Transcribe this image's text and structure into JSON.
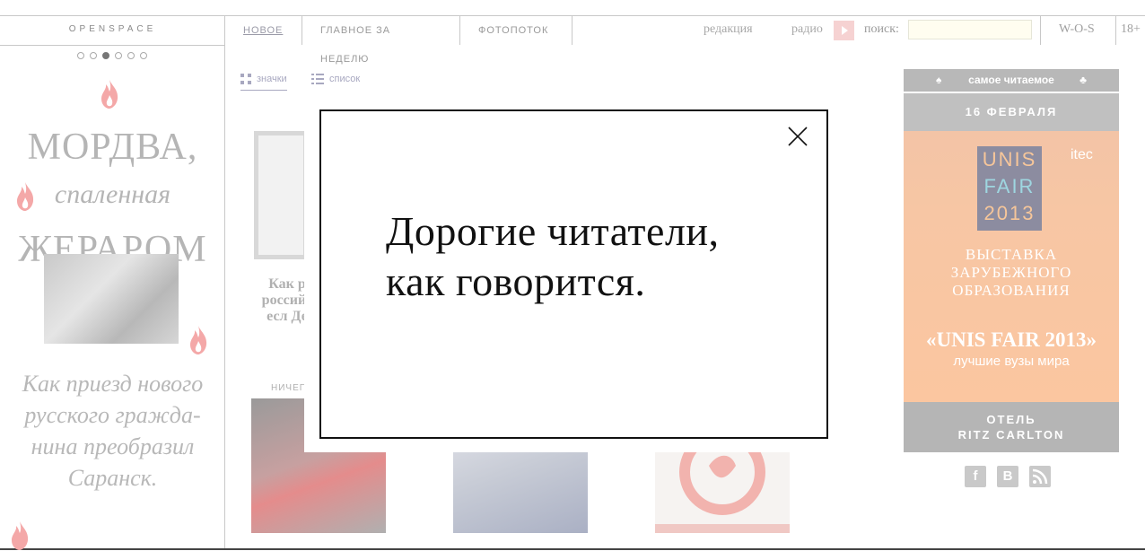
{
  "brand": "OPENSPACE",
  "tabs": [
    {
      "label": "НОВОЕ",
      "active": true
    },
    {
      "label": "ГЛАВНОЕ ЗА НЕДЕЛЮ",
      "active": false
    },
    {
      "label": "ФОТОПОТОК",
      "active": false
    }
  ],
  "nav": {
    "editorial": "редакция",
    "radio": "радио",
    "search_label": "поиск:",
    "search_value": "",
    "wos": "W-O-S",
    "age": "18+"
  },
  "slider": {
    "count": 6,
    "active_index": 2
  },
  "promo": {
    "title_line1": "МОРДВА,",
    "title_line2": "спаленная",
    "title_line3": "ЖЕРАРОМ",
    "text": "Как приезд нового русского гражда-нина преобразил Саранск."
  },
  "view": {
    "icons_label": "значки",
    "list_label": "список"
  },
  "cards": {
    "first_text": "Как р российс есл Де",
    "section_label": "НИЧЕГО"
  },
  "sidebar": {
    "header": "самое читаемое",
    "date": "16 ФЕВРАЛЯ",
    "ad": {
      "logo_line1": "UNIS",
      "logo_line2": "FAIR",
      "logo_line3": "2013",
      "brand": "itec",
      "headline_line1": "ВЫСТАВКА",
      "headline_line2": "ЗАРУБЕЖНОГО",
      "headline_line3": "ОБРАЗОВАНИЯ",
      "event": "«UNIS FAIR 2013»",
      "tagline": "лучшие вузы мира"
    },
    "footer_line1": "ОТЕЛЬ",
    "footer_line2": "RITZ CARLTON"
  },
  "social": [
    "f",
    "B"
  ],
  "modal": {
    "line1": "Дорогие читатели,",
    "line2": "как говорится."
  },
  "colors": {
    "flame": "#f4a8a8",
    "ad_bg": "#f7c6a4",
    "accent_link": "#9b9ba8"
  }
}
